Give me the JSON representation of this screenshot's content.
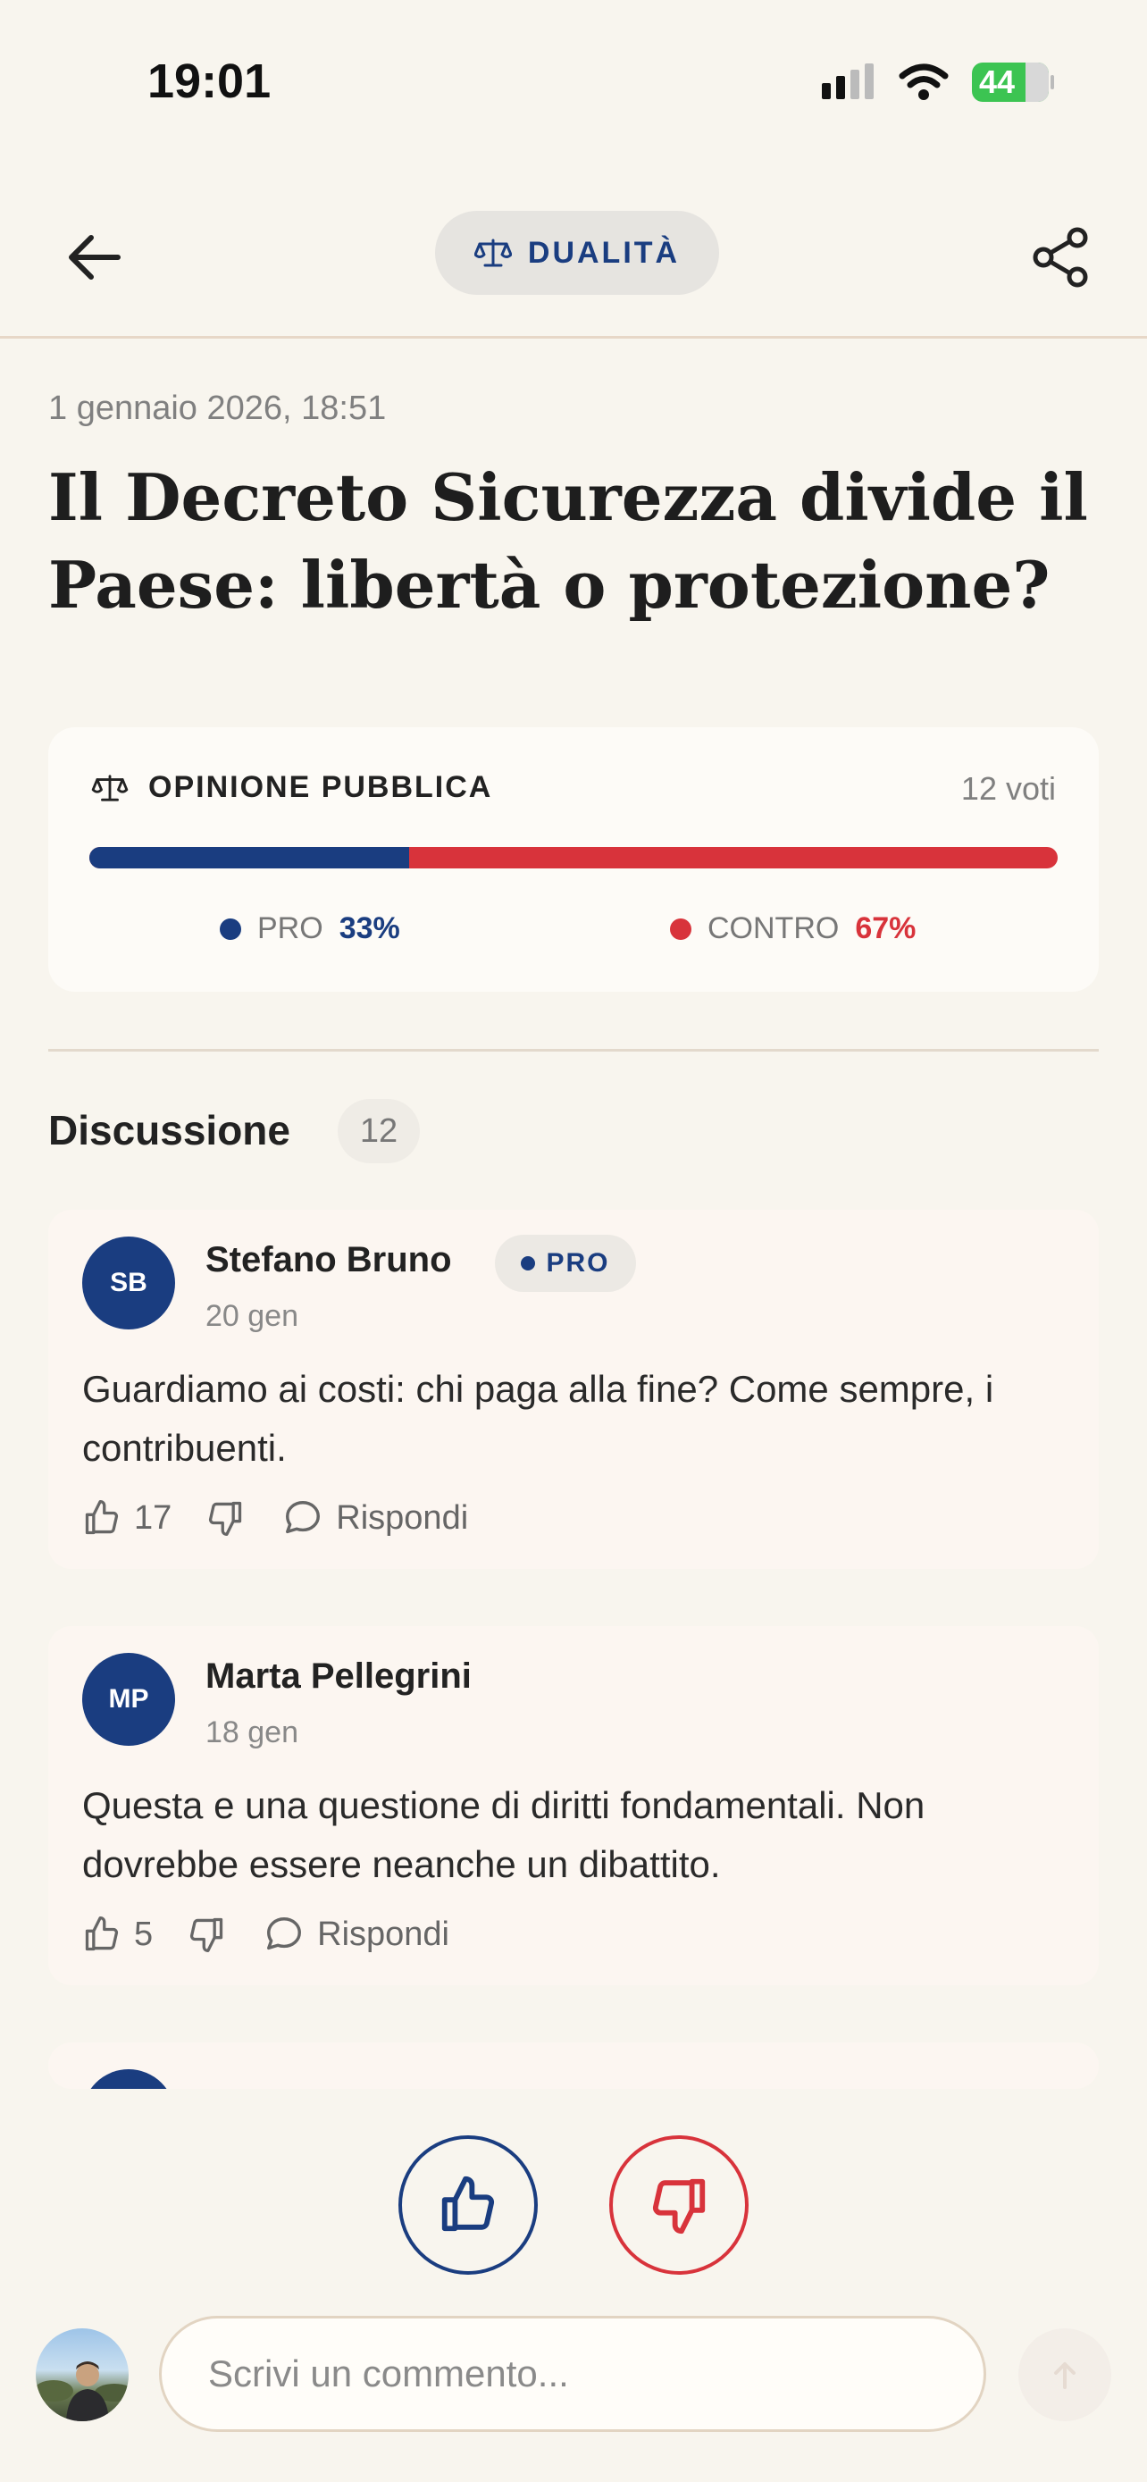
{
  "status_bar": {
    "time": "19:01",
    "battery": "44"
  },
  "header": {
    "section_label": "DUALITÀ"
  },
  "article": {
    "date": "1 gennaio 2026, 18:51",
    "title": "Il Decreto Sicurezza divide il Paese: libertà o protezione?"
  },
  "opinion": {
    "title": "OPINIONE PUBBLICA",
    "votes_label": "12 voti",
    "pro_label": "PRO",
    "pro_percent": "33%",
    "pro_fraction": 0.33,
    "contro_label": "CONTRO",
    "contro_percent": "67%",
    "colors": {
      "pro": "#1a3d80",
      "contro": "#d8333b"
    }
  },
  "discussion": {
    "title": "Discussione",
    "count": "12",
    "comments": [
      {
        "initials": "SB",
        "author": "Stefano Bruno",
        "stance": "PRO",
        "date": "20 gen",
        "text": "Guardiamo ai costi: chi paga alla fine? Come sempre, i contribuenti.",
        "likes": "17",
        "reply_label": "Rispondi"
      },
      {
        "initials": "MP",
        "author": "Marta Pellegrini",
        "date": "18 gen",
        "text": "Questa e una questione di diritti fondamentali. Non dovrebbe essere neanche un dibattito.",
        "likes": "5",
        "reply_label": "Rispondi"
      }
    ]
  },
  "composer": {
    "placeholder": "Scrivi un commento..."
  }
}
